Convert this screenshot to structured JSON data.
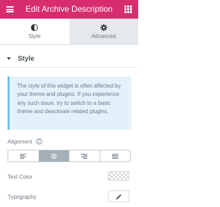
{
  "header": {
    "title": "Edit Archive Description",
    "menu_icon": "hamburger-menu-icon",
    "apps_icon": "grid-apps-icon",
    "color": "#d72d6e"
  },
  "tabs": [
    {
      "label": "Style",
      "icon": "half-circle-style-icon",
      "active": true
    },
    {
      "label": "Advanced",
      "icon": "gear-icon",
      "active": false
    }
  ],
  "section": {
    "title": "Style",
    "notice": "The style of this widget is often affected by your theme and plugins. If you experience any such issue, try to switch to a basic theme and deactivate related plugins.",
    "alignment_label": "Alignment",
    "alignment_options": [
      "left",
      "center",
      "right",
      "justify"
    ],
    "alignment_selected": "center",
    "text_color_label": "Text Color",
    "typography_label": "Typography"
  }
}
